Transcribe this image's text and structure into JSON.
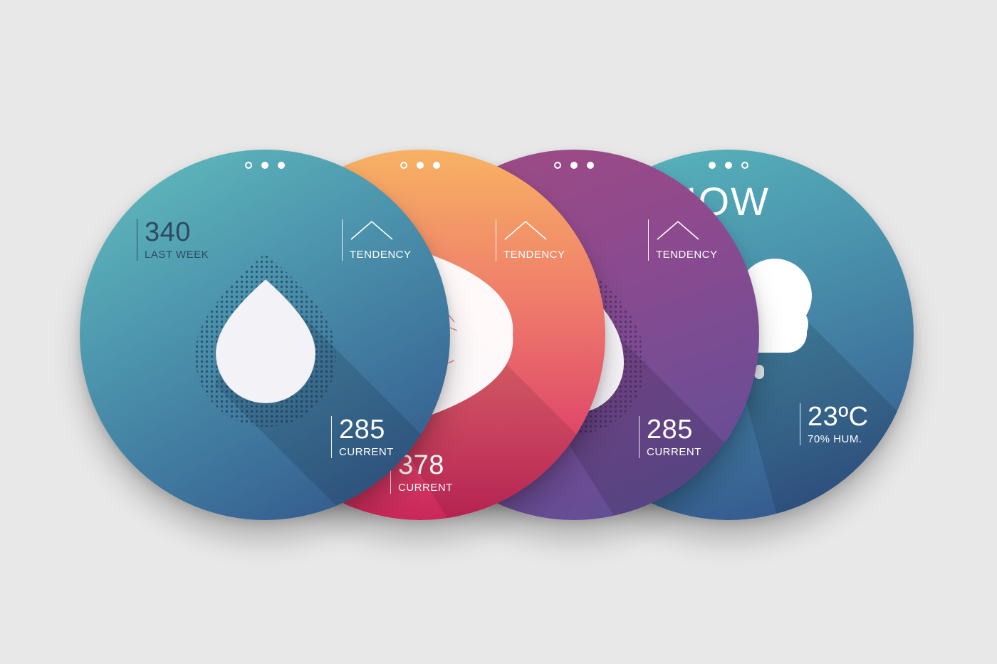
{
  "watches": [
    {
      "dots": [
        "ring",
        "filled",
        "filled"
      ],
      "metric_top": {
        "value": "340",
        "label": "LAST WEEK"
      },
      "tendency_label": "TENDENCY",
      "metric_bottom": {
        "value": "285",
        "label": "CURRENT"
      },
      "icon": "water-drop-icon"
    },
    {
      "dots": [
        "ring",
        "filled",
        "filled"
      ],
      "tendency_label": "TENDENCY",
      "metric_bottom": {
        "value": "378",
        "label": "CURRENT"
      },
      "icon": "crescent-icon"
    },
    {
      "dots": [
        "ring",
        "filled",
        "filled"
      ],
      "tendency_label": "TENDENCY",
      "metric_bottom": {
        "value": "285",
        "label": "CURRENT"
      },
      "icon": "water-drop-icon"
    },
    {
      "dots": [
        "filled",
        "filled",
        "ring"
      ],
      "title_partial": "IOW",
      "metric_bottom": {
        "value": "23ºC",
        "label": "70% HUM."
      },
      "icon": "cloud-icon"
    }
  ],
  "colors": {
    "teal": "#4c94ad",
    "orange_red": "#e04a6a",
    "purple": "#7a4c93",
    "background": "#e8e8e8"
  }
}
